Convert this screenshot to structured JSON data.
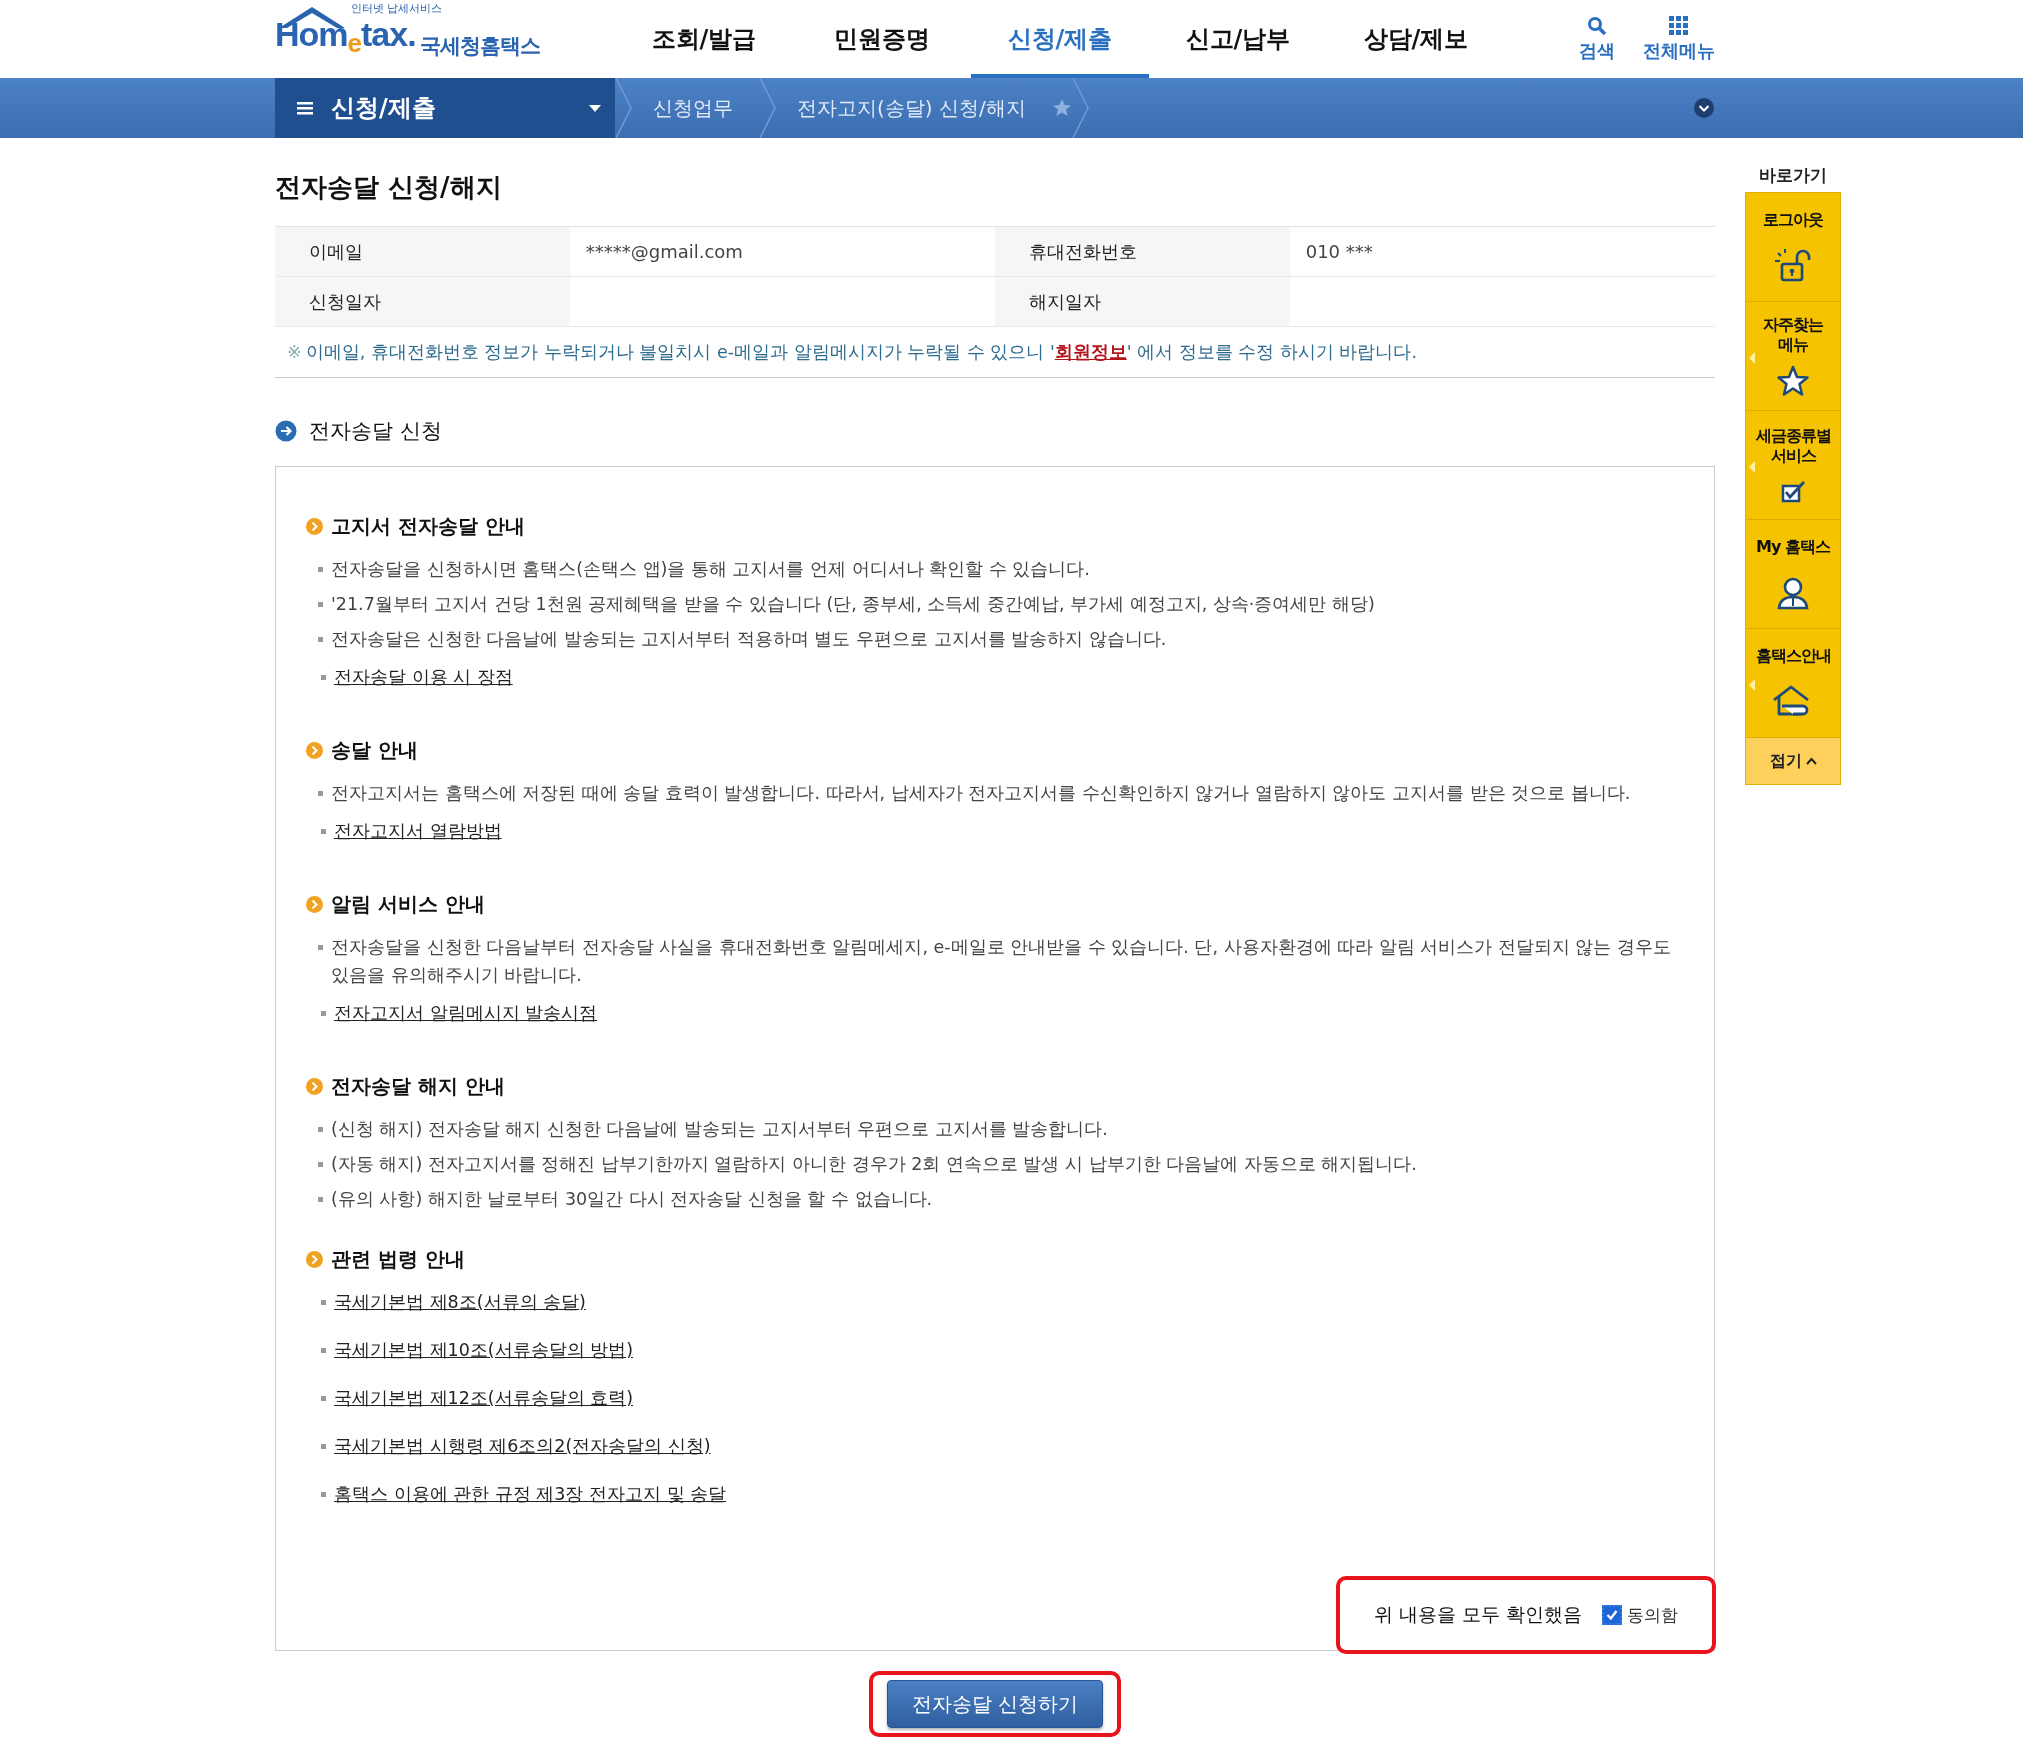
{
  "header": {
    "logo": {
      "tagline": "인터넷 납세서비스",
      "wordmark": "Hom$_{e}$tax.",
      "name": "국세청홈택스"
    },
    "nav": [
      {
        "label": "조회/발급",
        "selected": false
      },
      {
        "label": "민원증명",
        "selected": false
      },
      {
        "label": "신청/제출",
        "selected": true
      },
      {
        "label": "신고/납부",
        "selected": false
      },
      {
        "label": "상담/제보",
        "selected": false
      }
    ],
    "tools": [
      {
        "kind": "search",
        "label": "검색"
      },
      {
        "kind": "grid",
        "label": "전체메뉴"
      }
    ]
  },
  "breadcrumb": {
    "menu": "신청/제출",
    "path": [
      "신청업무",
      "전자고지(송달) 신청/해지"
    ],
    "favorite": false
  },
  "page_title": "전자송달 신청/해지",
  "info_table": [
    {
      "cells": [
        {
          "label": "이메일",
          "value": "*****@gmail.com"
        },
        {
          "label": "휴대전화번호",
          "value": "010        ***"
        }
      ]
    },
    {
      "cells": [
        {
          "label": "신청일자"
        },
        {
          "label": "해지일자"
        }
      ]
    }
  ],
  "notice": {
    "mark": "※",
    "before": "이메일, 휴대전화번호 정보가 누락되거나 불일치시 e-메일과 알림메시지가 누락될 수 있으니 '",
    "link": "회원정보",
    "after": "' 에서 정보를 수정 하시기 바랍니다."
  },
  "section_title": "전자송달 신청",
  "guide": [
    {
      "heading": "고지서 전자송달 안내",
      "items": [
        {
          "kind": "text",
          "text": "전자송달을 신청하시면 홈택스(손택스 앱)을 통해 고지서를 언제 어디서나 확인할 수 있습니다."
        },
        {
          "kind": "text",
          "text": "'21.7월부터 고지서 건당 1천원 공제혜택을 받을 수 있습니다 (단, 종부세, 소득세 중간예납, 부가세 예정고지, 상속·증여세만 해당)"
        },
        {
          "kind": "text",
          "text": "전자송달은 신청한 다음날에 발송되는 고지서부터 적용하며 별도 우편으로 고지서를 발송하지 않습니다."
        },
        {
          "kind": "link",
          "text": "전자송달 이용 시 장점"
        }
      ]
    },
    {
      "heading": "송달 안내",
      "items": [
        {
          "kind": "text",
          "text": "전자고지서는 홈택스에 저장된 때에 송달 효력이 발생합니다. 따라서, 납세자가 전자고지서를 수신확인하지 않거나 열람하지 않아도 고지서를 받은 것으로 봅니다."
        },
        {
          "kind": "link",
          "text": "전자고지서 열람방법"
        }
      ]
    },
    {
      "heading": "알림 서비스 안내",
      "items": [
        {
          "kind": "text",
          "text": "전자송달을 신청한 다음날부터 전자송달 사실을 휴대전화번호 알림메세지, e-메일로 안내받을 수 있습니다. 단, 사용자환경에 따라 알림 서비스가 전달되지 않는 경우도 있음을 유의해주시기 바랍니다."
        },
        {
          "kind": "link",
          "text": "전자고지서 알림메시지 발송시점"
        }
      ]
    },
    {
      "heading": "전자송달 해지 안내",
      "items": [
        {
          "kind": "text",
          "text": "(신청 해지) 전자송달 해지 신청한 다음날에 발송되는 고지서부터 우편으로 고지서를 발송합니다."
        },
        {
          "kind": "text",
          "text": "(자동 해지) 전자고지서를 정해진 납부기한까지 열람하지 아니한 경우가 2회 연속으로 발생 시 납부기한 다음날에 자동으로 해지됩니다."
        },
        {
          "kind": "text",
          "text": "(유의 사항) 해지한 날로부터 30일간 다시 전자송달 신청을 할 수 없습니다."
        }
      ]
    },
    {
      "heading": "관련 법령 안내",
      "items": [
        {
          "kind": "link",
          "text": "국세기본법 제8조(서류의 송달)"
        },
        {
          "kind": "link",
          "text": "국세기본법 제10조(서류송달의 방법)"
        },
        {
          "kind": "link",
          "text": "국세기본법 제12조(서류송달의 효력)"
        },
        {
          "kind": "link",
          "text": "국세기본법 시행령 제6조의2(전자송달의 신청)"
        },
        {
          "kind": "link",
          "text": "홈택스 이용에 관한 규정 제3장 전자고지 및 송달"
        }
      ]
    }
  ],
  "agreement": {
    "text": "위 내용을 모두 확인했음",
    "checkbox_label": "동의함",
    "checked": true,
    "highlighted": true
  },
  "submit": {
    "label": "전자송달 신청하기",
    "highlighted": true
  },
  "quick_menu": {
    "title": "바로가기",
    "items": [
      {
        "label": "로그아웃",
        "kind": "lock",
        "has_submenu": false
      },
      {
        "label": "자주찾는 메뉴",
        "kind": "star",
        "has_submenu": true
      },
      {
        "label": "세금종류별 서비스",
        "kind": "check",
        "has_submenu": true
      },
      {
        "label": "My 홈택스",
        "kind": "person",
        "has_submenu": false
      },
      {
        "label": "홈택스안내",
        "kind": "house",
        "has_submenu": true
      }
    ],
    "collapse": "접기"
  }
}
